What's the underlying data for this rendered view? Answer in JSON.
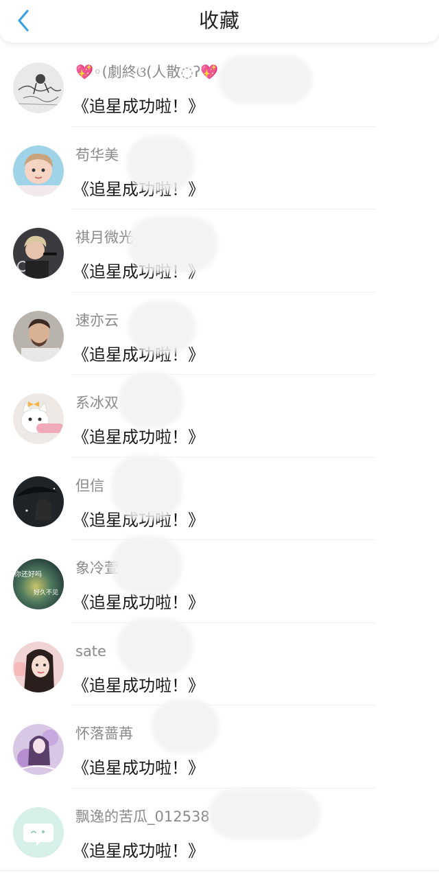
{
  "header": {
    "title": "收藏"
  },
  "items": [
    {
      "username": "💖◦(劇終ଓ(人散◌ʔ💖",
      "message": "《追星成功啦！》",
      "avatar": "sketch"
    },
    {
      "username": "苟华美",
      "message": "《追星成功啦！》",
      "avatar": "child"
    },
    {
      "username": "祺月微光",
      "message": "《追星成功啦！》",
      "avatar": "singer"
    },
    {
      "username": "速亦云",
      "message": "《追星成功啦！》",
      "avatar": "man"
    },
    {
      "username": "系冰双",
      "message": "《追星成功啦！》",
      "avatar": "cat"
    },
    {
      "username": "但信",
      "message": "《追星成功啦！》",
      "avatar": "umbrella"
    },
    {
      "username": "象冷萱",
      "message": "《追星成功啦！》",
      "avatar": "bokeh",
      "avatar_text": [
        "你还好吗",
        "好久不见"
      ]
    },
    {
      "username": "sate",
      "message": "《追星成功啦！》",
      "avatar": "girl"
    },
    {
      "username": "怀落蔷苒",
      "message": "《追星成功啦！》",
      "avatar": "anime"
    },
    {
      "username": "飘逸的苦瓜_012538",
      "message": "《追星成功啦！》",
      "avatar": "default"
    }
  ],
  "colors": {
    "back_arrow": "#3aa0e6",
    "default_avatar_bg": "#d7efe9"
  }
}
